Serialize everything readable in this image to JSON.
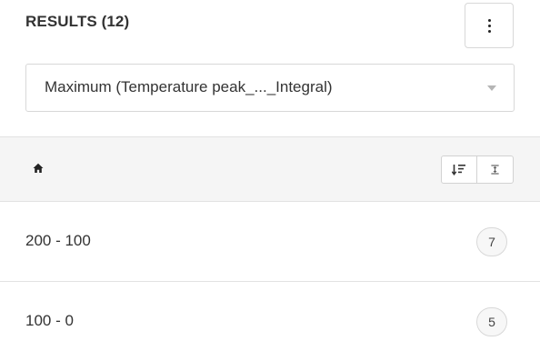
{
  "header": {
    "title": "RESULTS (12)",
    "menu_icon": "more-vertical-icon"
  },
  "attribute_select": {
    "selected": "Maximum (Temperature peak_..._Integral)",
    "caret_icon": "caret-down-icon"
  },
  "breadcrumb_bar": {
    "home_icon": "home-icon",
    "sort_icon": "sort-icon",
    "expand_icon": "expand-collapse-icon"
  },
  "results": [
    {
      "label": "200 - 100",
      "count": "7"
    },
    {
      "label": "100 - 0",
      "count": "5"
    }
  ],
  "colors": {
    "text": "#333333",
    "border": "#d8d8d8",
    "bar_background": "#f5f5f5",
    "badge_background": "#f7f7f7"
  }
}
